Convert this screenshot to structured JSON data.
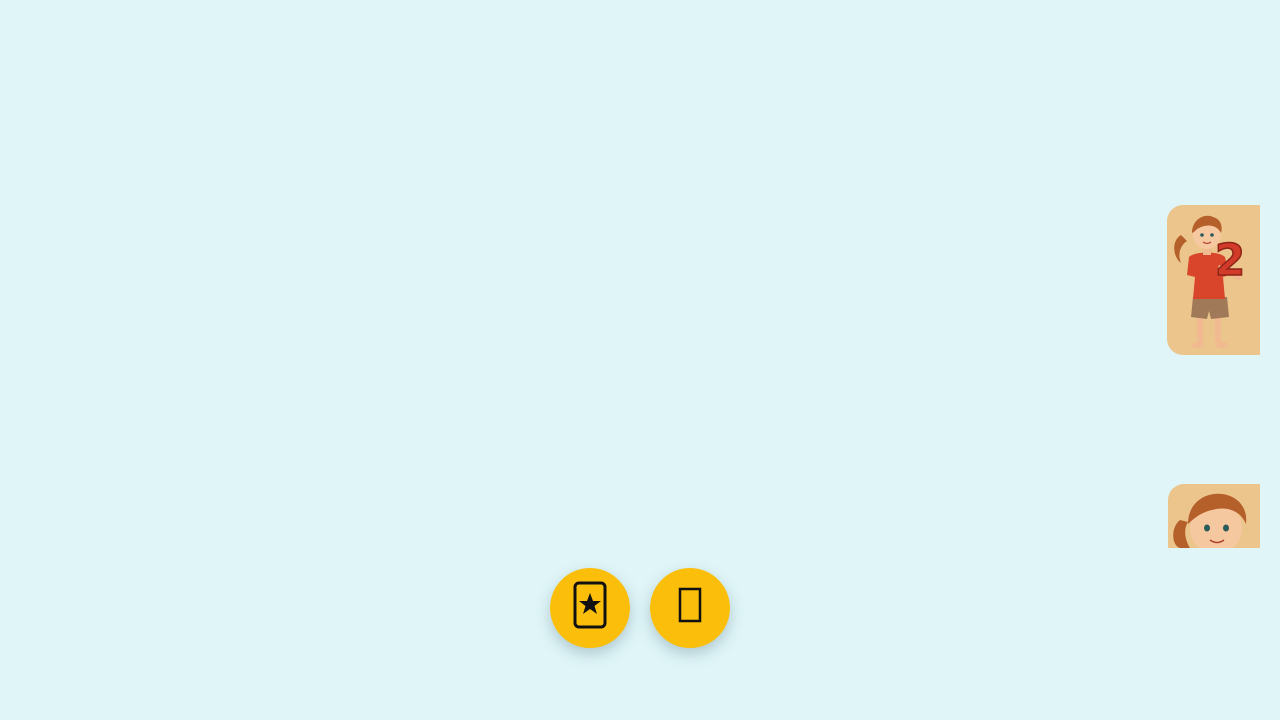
{
  "cards": [
    {
      "icon": "girl-holding-number-icon",
      "number": "2"
    },
    {
      "icon": "girl-portrait-icon"
    }
  ],
  "buttons": [
    {
      "icon": "star-card-icon",
      "glyph": "🃏"
    },
    {
      "icon": "unknown-glyph-icon",
      "glyph": "▯"
    }
  ],
  "colors": {
    "background": "#dff5f8",
    "card": "#ecc58c",
    "button": "#fbbe0a",
    "shirt": "#d8452b",
    "number": "#d23a2a"
  }
}
